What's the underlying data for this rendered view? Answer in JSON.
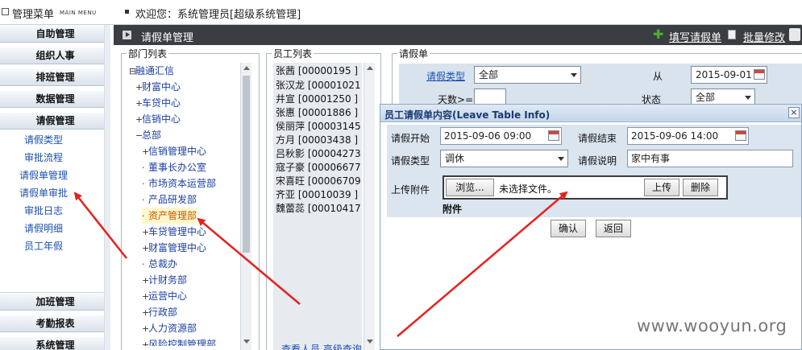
{
  "topbar": {
    "menu_title": "管理菜单",
    "menu_subtitle": "MAIN MENU",
    "welcome": "欢迎您：系统管理员[超级系统管理]"
  },
  "sidebar": {
    "groups_top": [
      "自助管理",
      "组织人事",
      "排班管理",
      "数据管理",
      "请假管理"
    ],
    "leave_items": [
      "请假类型",
      "审批流程",
      "请假单管理",
      "请假单审批",
      "审批日志",
      "请假明细",
      "员工年假"
    ],
    "groups_bottom": [
      "加班管理",
      "考勤报表",
      "系统管理"
    ]
  },
  "header": {
    "title": "请假单管理",
    "fill_leave": "填写请假单",
    "batch_edit": "批量修改"
  },
  "dept_panel": {
    "legend": "部门列表",
    "root": "融通汇信",
    "nodes": [
      "财富中心",
      "车贷中心",
      "信销中心",
      "总部",
      "信销管理中心",
      "董事长办公室",
      "市场资本运营部",
      "产品研发部",
      "资产管理部",
      "车贷管理中心",
      "财富管理中心",
      "总裁办",
      "计财务部",
      "运营中心",
      "行政部",
      "人力资源部",
      "风险控制管理部"
    ]
  },
  "emp_panel": {
    "legend": "员工列表",
    "employees": [
      "张茜 [00000195 ]",
      "张汉龙 [00001021",
      "井宣 [00001250 ]",
      "张惠 [00001886 ]",
      "侯丽萍 [00003145",
      "方月 [00003438 ]",
      "吕秋影 [00004273",
      "寇子豪 [00006677",
      "宋喜旺 [00006709",
      "齐亚 [00010039 ]",
      "魏蕾蕊 [00010417"
    ],
    "bottom_links": "查看人员  高级查询"
  },
  "filter_panel": {
    "legend": "请假单",
    "leave_type_label": "请假类型",
    "leave_type_value": "全部",
    "from_label": "从",
    "from_value": "2015-09-01",
    "days_label": "天数>=",
    "status_label": "状态",
    "status_value": "全部"
  },
  "modal": {
    "title": "员工请假单内容(Leave Table Info)",
    "close": "×",
    "start_label": "请假开始",
    "start_value": "2015-09-06 09:00",
    "end_label": "请假结束",
    "end_value": "2015-09-06 14:00",
    "type_label": "请假类型",
    "type_value": "调休",
    "reason_label": "请假说明",
    "reason_value": "家中有事",
    "attach_label": "上传附件",
    "browse_button": "浏览...",
    "no_file": "未选择文件。",
    "upload_button": "上传",
    "delete_button": "删除",
    "attach_list_label": "附件",
    "confirm_button": "确认",
    "back_button": "返回"
  },
  "watermark": "www.wooyun.org",
  "colors": {
    "header_bg": "#3a3d42",
    "link_blue": "#1a4fb0",
    "arrow_red": "#e8201c",
    "form_bg": "#dbe5f0"
  }
}
